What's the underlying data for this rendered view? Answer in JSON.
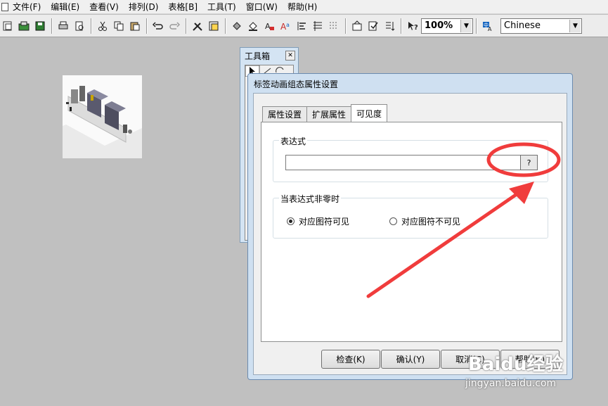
{
  "menu": [
    "文件(F)",
    "编辑(E)",
    "查看(V)",
    "排列(D)",
    "表格[B]",
    "工具(T)",
    "窗口(W)",
    "帮助(H)"
  ],
  "toolbar": {
    "zoom_value": "100%",
    "language_value": "Chinese"
  },
  "toolbox": {
    "title": "工具箱"
  },
  "dialog": {
    "title": "标签动画组态属性设置",
    "tabs": [
      "属性设置",
      "扩展属性",
      "可见度"
    ],
    "expression_group_label": "表达式",
    "expression_value": "",
    "expression_help_label": "?",
    "nonzero_group_label": "当表达式非零时",
    "radio_visible_label": "对应图符可见",
    "radio_invisible_label": "对应图符不可见",
    "buttons": {
      "check": "检查(K)",
      "confirm": "确认(Y)",
      "cancel": "取消(C)",
      "help": "帮助(H)"
    }
  },
  "watermark": {
    "brand": "Baidu经验",
    "url": "jingyan.baidu.com"
  },
  "colors": {
    "annotation": "#f03c3c",
    "desktop": "#c0c0c0",
    "dialog_frame": "#cfe0f1"
  }
}
